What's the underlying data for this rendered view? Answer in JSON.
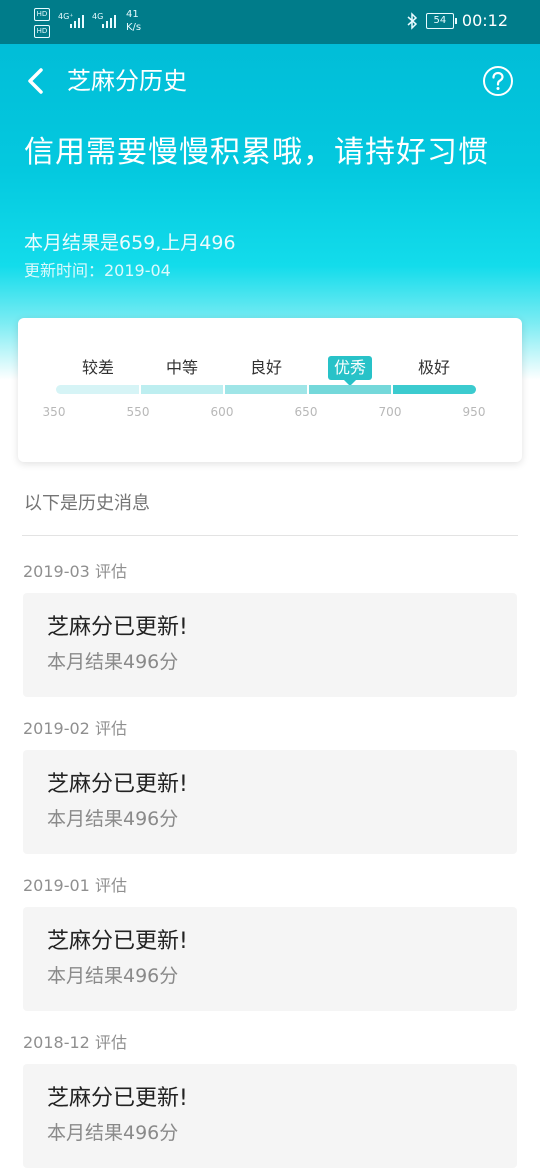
{
  "status_bar": {
    "hd1": "HD",
    "hd2": "HD",
    "signal1": "4G⁺",
    "signal2": "4G",
    "speed_value": "41",
    "speed_unit": "K/s",
    "battery": "54",
    "time": "00:12"
  },
  "nav": {
    "title": "芝麻分历史"
  },
  "hero": {
    "title": "信用需要慢慢积累哦，请持好习惯",
    "subtitle": "本月结果是659,上月496",
    "updated": "更新时间：2019-04"
  },
  "score_levels": {
    "levels": [
      "较差",
      "中等",
      "良好",
      "优秀",
      "极好"
    ],
    "active_index": 3,
    "ticks": [
      "350",
      "550",
      "600",
      "650",
      "700",
      "950"
    ],
    "segment_colors": [
      "#d6f4f6",
      "#bdeef0",
      "#9fe5e7",
      "#74d8da",
      "#3ccbcf"
    ]
  },
  "history": {
    "label": "以下是历史消息",
    "entries": [
      {
        "date": "2019-03 评估",
        "title": "芝麻分已更新!",
        "desc": "本月结果496分"
      },
      {
        "date": "2019-02 评估",
        "title": "芝麻分已更新!",
        "desc": "本月结果496分"
      },
      {
        "date": "2019-01 评估",
        "title": "芝麻分已更新!",
        "desc": "本月结果496分"
      },
      {
        "date": "2018-12 评估",
        "title": "芝麻分已更新!",
        "desc": "本月结果496分"
      }
    ]
  }
}
